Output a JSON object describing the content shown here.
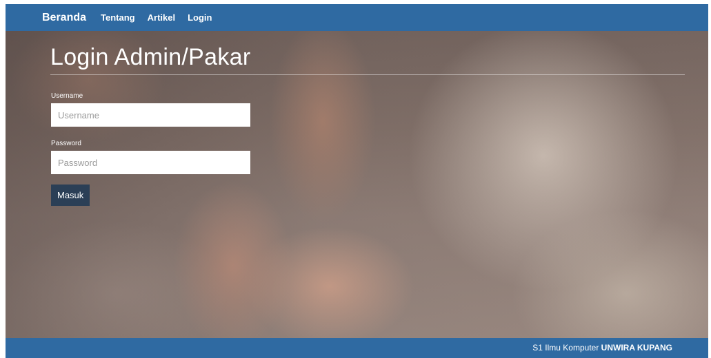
{
  "navbar": {
    "brand": "Beranda",
    "links": [
      "Tentang",
      "Artikel",
      "Login"
    ]
  },
  "login": {
    "title": "Login Admin/Pakar",
    "username_label": "Username",
    "username_placeholder": "Username",
    "username_value": "",
    "password_label": "Password",
    "password_placeholder": "Password",
    "password_value": "",
    "submit_label": "Masuk"
  },
  "footer": {
    "text": "S1 Ilmu Komputer",
    "emphasis": "UNWIRA KUPANG"
  },
  "colors": {
    "navbar": "#2f6aa2",
    "button": "#2b3f56"
  }
}
